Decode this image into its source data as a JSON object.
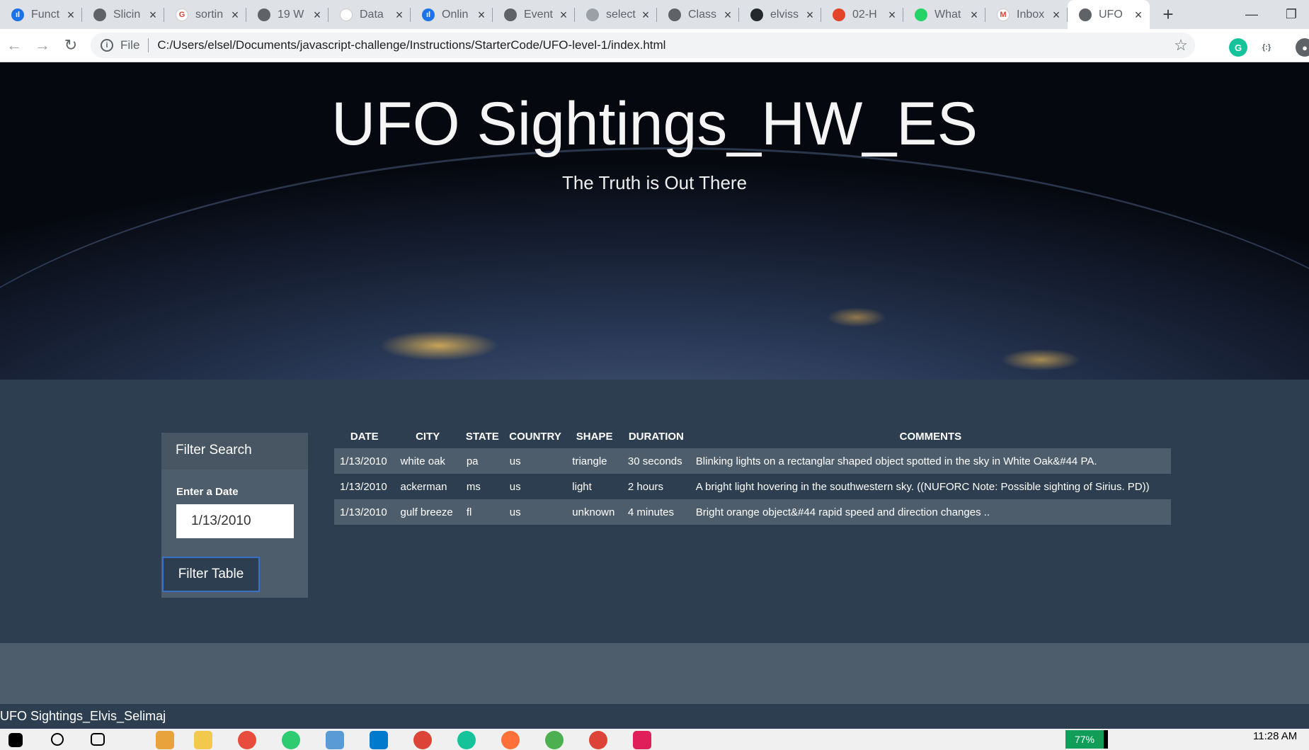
{
  "browser": {
    "tabs": [
      {
        "title": "Funct",
        "icon": "chart-favicon-icon",
        "color": "#1a73e8",
        "glyph": "ıl"
      },
      {
        "title": "Slicin",
        "icon": "globe-favicon-icon",
        "color": "#5f6368",
        "glyph": ""
      },
      {
        "title": "sortin",
        "icon": "google-favicon-icon",
        "color": "#ffffff",
        "glyph": "G"
      },
      {
        "title": "19 W",
        "icon": "globe-favicon-icon",
        "color": "#5f6368",
        "glyph": ""
      },
      {
        "title": "Data",
        "icon": "document-favicon-icon",
        "color": "#ffffff",
        "glyph": ""
      },
      {
        "title": "Onlin",
        "icon": "chart-favicon-icon",
        "color": "#1a73e8",
        "glyph": "ıl"
      },
      {
        "title": "Event",
        "icon": "globe-favicon-icon",
        "color": "#5f6368",
        "glyph": ""
      },
      {
        "title": "select",
        "icon": "circle-favicon-icon",
        "color": "#9aa0a6",
        "glyph": ""
      },
      {
        "title": "Class",
        "icon": "globe-favicon-icon",
        "color": "#5f6368",
        "glyph": ""
      },
      {
        "title": "elviss",
        "icon": "github-favicon-icon",
        "color": "#24292e",
        "glyph": ""
      },
      {
        "title": "02-H",
        "icon": "gitlab-favicon-icon",
        "color": "#e24329",
        "glyph": ""
      },
      {
        "title": "What",
        "icon": "whatsapp-favicon-icon",
        "color": "#25d366",
        "glyph": ""
      },
      {
        "title": "Inbox",
        "icon": "gmail-favicon-icon",
        "color": "#ffffff",
        "glyph": "M"
      },
      {
        "title": "UFO",
        "icon": "globe-favicon-icon",
        "color": "#5f6368",
        "glyph": "",
        "active": true
      }
    ],
    "address_scheme": "File",
    "address_url": "C:/Users/elsel/Documents/javascript-challenge/Instructions/StarterCode/UFO-level-1/index.html"
  },
  "page": {
    "title": "UFO Sightings_HW_ES",
    "subtitle": "The Truth is Out There",
    "filter": {
      "heading": "Filter Search",
      "date_label": "Enter a Date",
      "date_value": "1/13/2010",
      "button_label": "Filter Table"
    },
    "table": {
      "headers": [
        "DATE",
        "CITY",
        "STATE",
        "COUNTRY",
        "SHAPE",
        "DURATION",
        "COMMENTS"
      ],
      "rows": [
        [
          "1/13/2010",
          "white oak",
          "pa",
          "us",
          "triangle",
          "30 seconds",
          "Blinking lights on a rectanglar shaped object spotted in the sky in White Oak&#44 PA."
        ],
        [
          "1/13/2010",
          "ackerman",
          "ms",
          "us",
          "light",
          "2 hours",
          "A bright light hovering in the southwestern sky. ((NUFORC Note: Possible sighting of Sirius. PD))"
        ],
        [
          "1/13/2010",
          "gulf breeze",
          "fl",
          "us",
          "unknown",
          "4 minutes",
          "Bright orange object&#44 rapid speed and direction changes .."
        ]
      ]
    },
    "footer": "UFO Sightings_Elvis_Selimaj"
  },
  "taskbar": {
    "battery": "77%",
    "time": "11:28 AM"
  }
}
